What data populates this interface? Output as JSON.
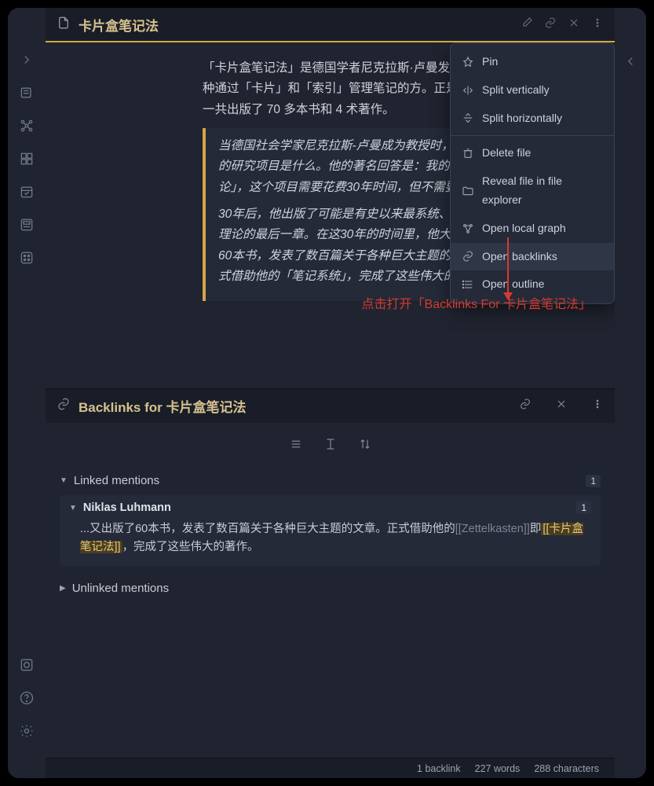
{
  "editor": {
    "title": "卡片盒笔记法",
    "paragraph": "「卡片盒笔记法」是德国学者尼克拉斯·卢曼发明的一种「方法」，它是一种通过「卡片」和「索引」管理笔记的方。正是使用 Zettelkasten 一生中一共出版了 70 多本书和 4 术著作。",
    "quote1": "当德国社会学家尼克拉斯-卢曼成为教授时，有人问要的研究项目是什么。他的著名回答是：我的项目会理论」，这个项目需要花费30年时间，但不需要用。",
    "quote2": "30年后，他出版了可能是有史以来最系统、最全面学理论的最后一章。在这30年的时间里，他大概又……60本书，发表了数百篇关于各种巨大主题的文章。正式借助他的「笔记系统」，完成了这些伟大的著作。"
  },
  "annotation": "点击打开「Backlinks For 卡片盒笔记法」",
  "ctx": {
    "pin": "Pin",
    "splitv": "Split vertically",
    "splith": "Split horizontally",
    "delete": "Delete file",
    "reveal": "Reveal file in file explorer",
    "graph": "Open local graph",
    "backlinks": "Open backlinks",
    "outline": "Open outline"
  },
  "backlinks": {
    "title": "Backlinks for 卡片盒笔记法",
    "linked_label": "Linked mentions",
    "linked_count": "1",
    "file_name": "Niklas Luhmann",
    "file_count": "1",
    "snippet_pre": "...又出版了60本书，发表了数百篇关于各种巨大主题的文章。正式借助他的",
    "snippet_zk": "[[Zettelkasten]]",
    "snippet_mid": "即",
    "snippet_hit": "[[卡片盒笔记法]]",
    "snippet_post": "，完成了这些伟大的著作。",
    "unlinked_label": "Unlinked mentions"
  },
  "status": {
    "backlink": "1 backlink",
    "words": "227 words",
    "chars": "288 characters"
  }
}
